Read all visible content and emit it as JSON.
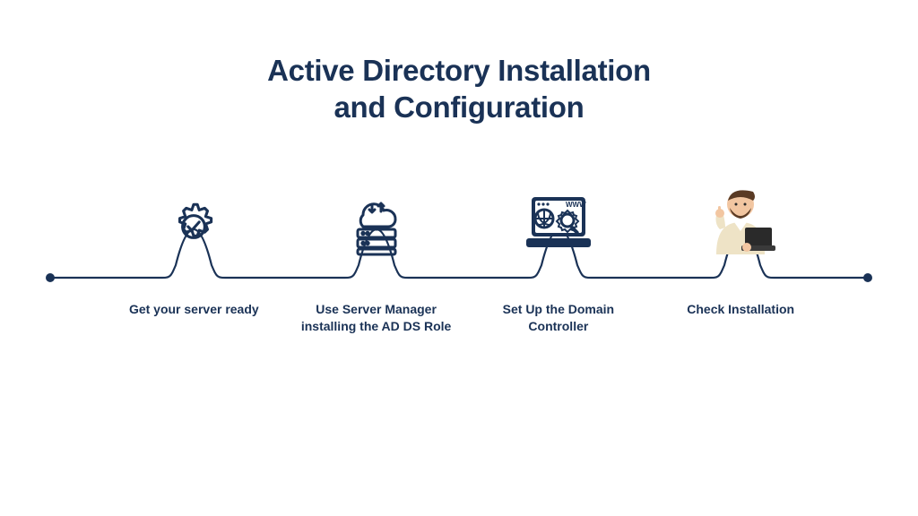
{
  "title_line1": "Active Directory Installation",
  "title_line2": "and Configuration",
  "steps": [
    {
      "icon": "gear-check",
      "label": "Get your server ready"
    },
    {
      "icon": "cloud-server",
      "label": "Use Server Manager installing the AD DS Role"
    },
    {
      "icon": "laptop-www",
      "label": "Set Up the Domain Controller"
    },
    {
      "icon": "person-laptop",
      "label": "Check Installation"
    }
  ],
  "colors": {
    "primary": "#1a3256",
    "skin": "#f2c6a1",
    "shirt": "#eee3c6",
    "laptop": "#2a2a2a"
  }
}
